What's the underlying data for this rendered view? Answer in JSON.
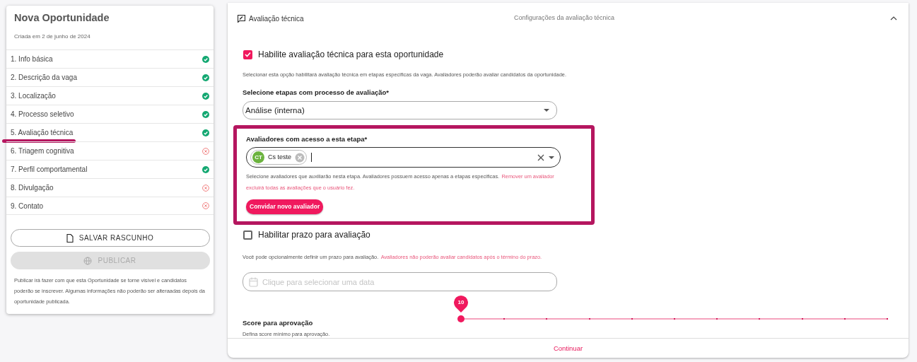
{
  "sidebar": {
    "title": "Nova Oportunidade",
    "created": "Criada em 2 de junho de 2024",
    "steps": [
      {
        "label": "1. Info básica",
        "done": true,
        "underlined": false
      },
      {
        "label": "2. Descrição da vaga",
        "done": true,
        "underlined": false
      },
      {
        "label": "3. Localização",
        "done": true,
        "underlined": false
      },
      {
        "label": "4. Processo seletivo",
        "done": true,
        "underlined": false
      },
      {
        "label": "5. Avaliação técnica",
        "done": true,
        "underlined": true
      },
      {
        "label": "6. Triagem cognitiva",
        "done": false,
        "underlined": false
      },
      {
        "label": "7. Perfil comportamental",
        "done": true,
        "underlined": false
      },
      {
        "label": "8. Divulgação",
        "done": false,
        "underlined": false
      },
      {
        "label": "9. Contato",
        "done": false,
        "underlined": false
      }
    ],
    "save_button": "SALVAR RASCUNHO",
    "publish_button": {
      "label": "PUBLICAR",
      "disabled": true
    },
    "note": "Publicar irá fazer com que esta Oportunidade se torne visível e candidatos poderão se inscrever. Algumas informações não poderão ser alteraadas depois da oportunidade publicada."
  },
  "panel": {
    "title": "Avaliação técnica",
    "subtitle": "Configurações da avaliação técnica",
    "expanded": true,
    "enable": {
      "label": "Habilite avaliação técnica para esta oportunidade",
      "checked": true,
      "hint": "Selecionar esta opção habilitará avaliação técnica em etapas especificas da vaga. Avaliadores poderão avaliar candidatos da oportunidade."
    },
    "stages": {
      "label": "Selecione etapas com processo de avaliação*",
      "value": "Análise (interna)"
    },
    "evaluators": {
      "label": "Avaliadores com acesso a esta etapa*",
      "highlighted": true,
      "chips": [
        {
          "initials": "CT",
          "name": "Cs teste",
          "color": "#6cb33f"
        }
      ],
      "hint": "Selecione avaliadores que auxiliarão nesta etapa. Avaliadores possuem acesso apenas a etapas especificas.",
      "warning": "Remover um avaliador excluirá todas as avaliações que o usuário fez.",
      "invite_button": "Convidar novo avaliador"
    },
    "deadline": {
      "label": "Habilitar prazo para avaliação",
      "checked": false,
      "hint": "Você pode opcionalmente definir um prazo para avaliação.",
      "warning": "Avaliadores não poderão avaliar candidatos após o término do prazo.",
      "placeholder": "Clique para selecionar uma data"
    },
    "score": {
      "label": "Score para aprovação",
      "hint": "Defina score mínimo para aprovação.",
      "reading": "10",
      "level": 0
    },
    "continue": "Continuar"
  }
}
